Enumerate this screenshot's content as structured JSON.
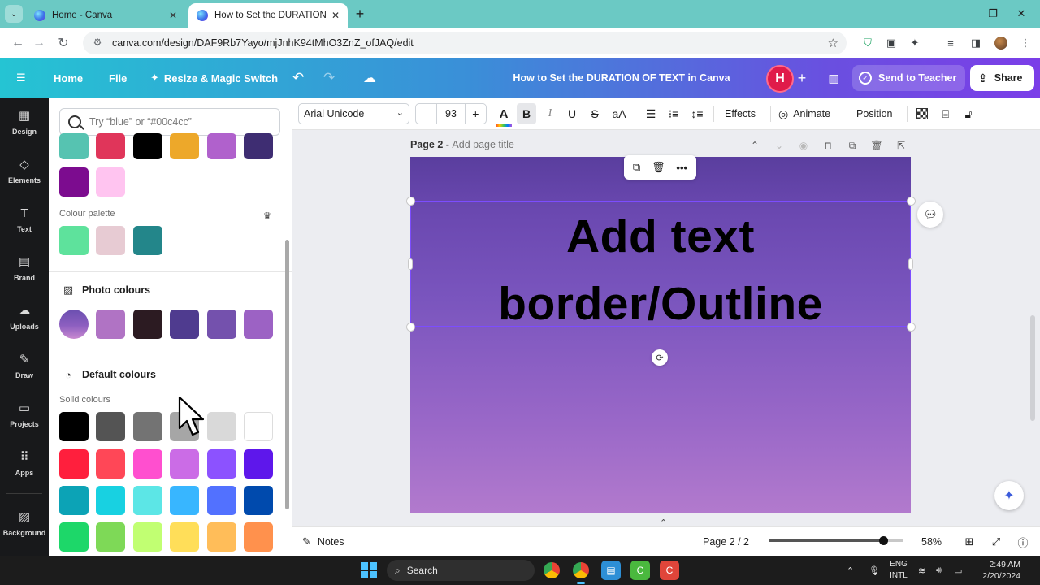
{
  "browser": {
    "tabs": [
      {
        "label": "Home - Canva",
        "active": false
      },
      {
        "label": "How to Set the DURATION OF T",
        "active": true
      }
    ],
    "url": "canva.com/design/DAF9Rb7Yayo/mjJnhK94tMhO3ZnZ_ofJAQ/edit"
  },
  "header": {
    "home": "Home",
    "file": "File",
    "resize": "Resize & Magic Switch",
    "doc_title": "How to Set the DURATION OF TEXT in Canva",
    "avatar_initial": "H",
    "send_label": "Send to Teacher",
    "share_label": "Share"
  },
  "rail": {
    "items": [
      {
        "label": "Design",
        "icon": "design-icon"
      },
      {
        "label": "Elements",
        "icon": "elements-icon"
      },
      {
        "label": "Text",
        "icon": "text-icon"
      },
      {
        "label": "Brand",
        "icon": "brand-icon"
      },
      {
        "label": "Uploads",
        "icon": "uploads-icon"
      },
      {
        "label": "Draw",
        "icon": "draw-icon"
      },
      {
        "label": "Projects",
        "icon": "projects-icon"
      },
      {
        "label": "Apps",
        "icon": "apps-icon"
      },
      {
        "label": "Background",
        "icon": "background-icon"
      }
    ]
  },
  "panel": {
    "search_placeholder": "Try “blue” or “#00c4cc”",
    "doc_colors_row1": [
      "#56c3b1",
      "#e0355a",
      "#000000",
      "#eda82a",
      "#b061cc",
      "#3e2d72"
    ],
    "doc_colors_row2": [
      "#7c0c8f",
      "#ffc4f0"
    ],
    "colour_palette_label": "Colour palette",
    "colour_palette": [
      "#5ee29c",
      "#e7cbd3",
      "#23868a"
    ],
    "photo_colours_label": "Photo colours",
    "photo_colours": [
      "#b073c4",
      "#2c1b22",
      "#4f3b8f",
      "#7451ad",
      "#9c62c4"
    ],
    "default_colours_label": "Default colours",
    "solid_colours_label": "Solid colours",
    "solid_colours": [
      [
        "#000000",
        "#545454",
        "#737373",
        "#a6a6a6",
        "#d9d9d9",
        "#ffffff"
      ],
      [
        "#ff1f3d",
        "#ff4757",
        "#ff4fcf",
        "#cb6ce6",
        "#8c52ff",
        "#5e17eb"
      ],
      [
        "#0ca3b6",
        "#18d1e1",
        "#5ce6e6",
        "#38b6ff",
        "#5271ff",
        "#004aad"
      ],
      [
        "#1dd769",
        "#7ed957",
        "#c1ff72",
        "#ffde59",
        "#ffbd59",
        "#ff914d"
      ]
    ]
  },
  "toolbar": {
    "font": "Arial Unicode",
    "size": "93",
    "effects": "Effects",
    "animate": "Animate",
    "position": "Position"
  },
  "page": {
    "label": "Page 2 - ",
    "title_placeholder": "Add page title",
    "text_line1": "Add text",
    "text_line2": "border/Outline"
  },
  "bottom": {
    "notes": "Notes",
    "page_indicator": "Page 2 / 2",
    "zoom": "58%",
    "zoom_fraction": 0.58
  },
  "taskbar": {
    "search": "Search",
    "lang1": "ENG",
    "lang2": "INTL",
    "time": "2:49 AM",
    "date": "2/20/2024"
  }
}
